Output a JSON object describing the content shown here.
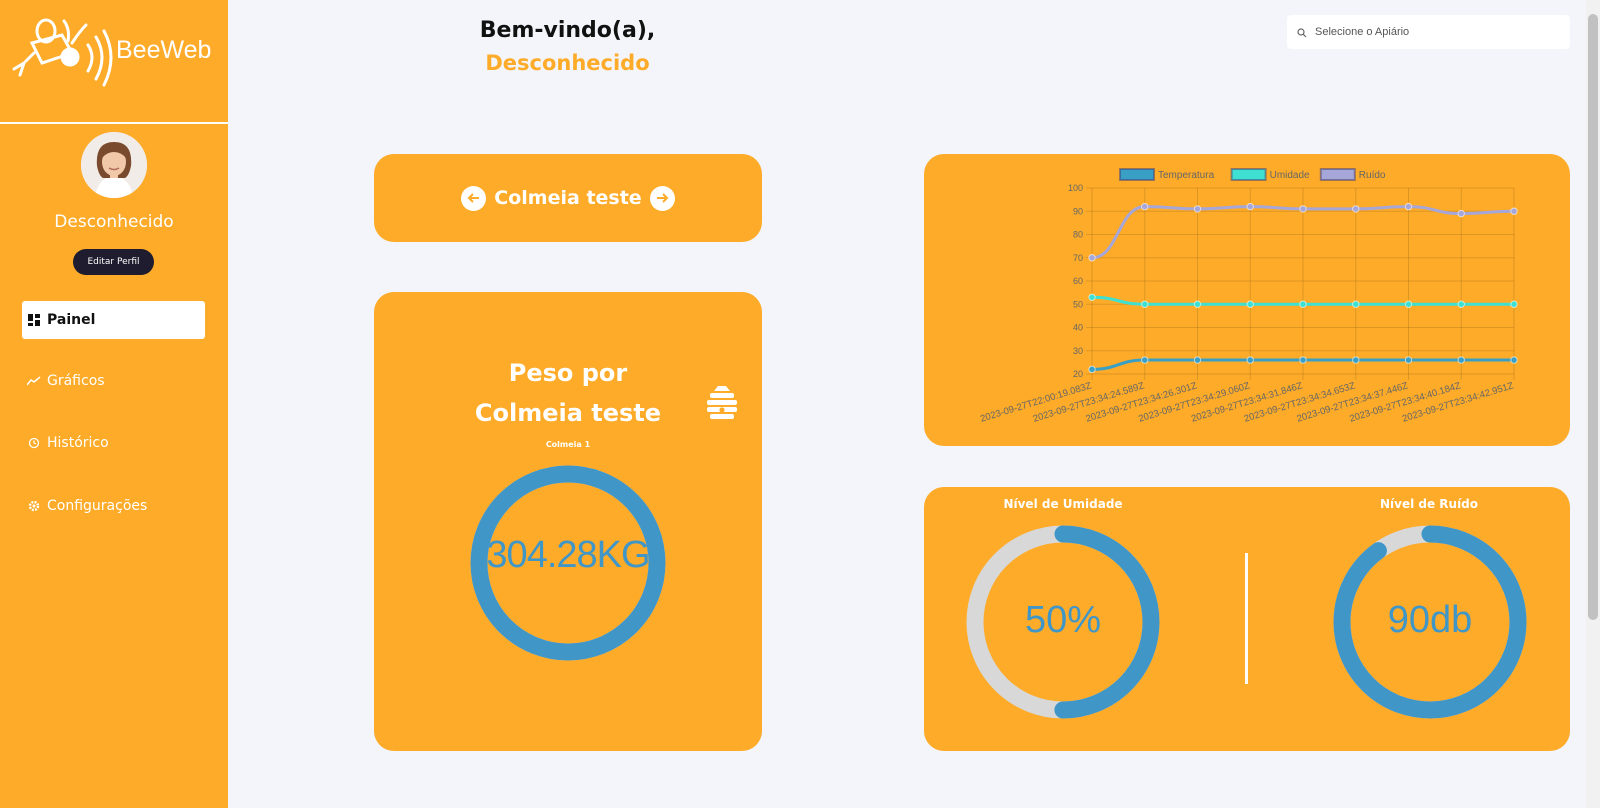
{
  "brand": {
    "name": "BeeWeb"
  },
  "user": {
    "name": "Desconhecido",
    "edit_label": "Editar Perfil"
  },
  "nav": [
    {
      "label": "Painel",
      "icon": "dashboard-icon",
      "active": true
    },
    {
      "label": "Gráficos",
      "icon": "line-chart-icon",
      "active": false
    },
    {
      "label": "Histórico",
      "icon": "history-icon",
      "active": false
    },
    {
      "label": "Configurações",
      "icon": "gear-icon",
      "active": false
    }
  ],
  "welcome": {
    "line1": "Bem-vindo(a),",
    "line2": "Desconhecido"
  },
  "search": {
    "placeholder": "Selecione o Apiário",
    "value": ""
  },
  "hive": {
    "name": "Colmeia teste"
  },
  "weight": {
    "title_line1": "Peso por",
    "title_line2": "Colmeia teste",
    "sub": "Colmeia 1",
    "value_label": "304.28KG",
    "fraction": 1.0
  },
  "levels": {
    "humidity": {
      "title": "Nível de Umidade",
      "value_label": "50%",
      "fraction": 0.5
    },
    "noise": {
      "title": "Nível de Ruído",
      "value_label": "90db",
      "fraction": 0.9
    }
  },
  "colors": {
    "accent": "#fdab28",
    "gauge": "#4196c8",
    "track": "#d8d8d8",
    "dark_button": "#1e1c2e",
    "temperature": "#3a9fc4",
    "humidity": "#3ee0d2",
    "noise": "#a6a6d8"
  },
  "chart_data": {
    "type": "line",
    "x": [
      "2023-09-27T22:00:19.083Z",
      "2023-09-27T23:34:24.589Z",
      "2023-09-27T23:34:26.301Z",
      "2023-09-27T23:34:29.060Z",
      "2023-09-27T23:34:31.846Z",
      "2023-09-27T23:34:34.653Z",
      "2023-09-27T23:34:37.446Z",
      "2023-09-27T23:34:40.184Z",
      "2023-09-27T23:34:42.951Z"
    ],
    "series": [
      {
        "name": "Temperatura",
        "values": [
          22,
          26,
          26,
          26,
          26,
          26,
          26,
          26,
          26
        ]
      },
      {
        "name": "Umidade",
        "values": [
          53,
          50,
          50,
          50,
          50,
          50,
          50,
          50,
          50
        ]
      },
      {
        "name": "Ruído",
        "values": [
          70,
          92,
          91,
          92,
          91,
          91,
          92,
          89,
          90
        ]
      }
    ],
    "yticks": [
      20,
      30,
      40,
      50,
      60,
      70,
      80,
      90,
      100
    ],
    "ylim": [
      20,
      100
    ],
    "grid": true,
    "legend": "top"
  }
}
